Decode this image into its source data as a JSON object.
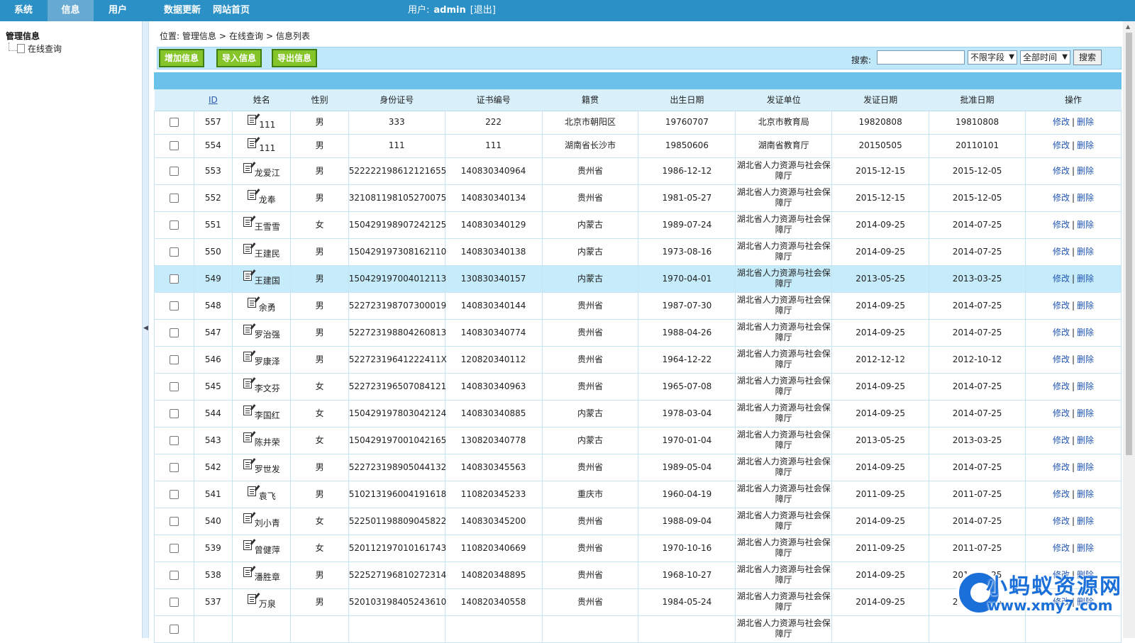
{
  "nav": {
    "items": [
      {
        "label": "系统"
      },
      {
        "label": "信息"
      },
      {
        "label": "用户"
      },
      {
        "label": "数据更新"
      },
      {
        "label": "网站首页"
      }
    ],
    "active_index": 1,
    "user_label": "用户:",
    "username": "admin",
    "logout": "[退出]"
  },
  "sidebar": {
    "root": "管理信息",
    "leaf": "在线查询"
  },
  "breadcrumb": {
    "prefix": "位置:",
    "items": [
      "管理信息",
      "在线查询",
      "信息列表"
    ],
    "sep": ">"
  },
  "toolbar": {
    "add": "增加信息",
    "import": "导入信息",
    "export": "导出信息",
    "search_label": "搜索:",
    "search_value": "",
    "field_select": "不限字段",
    "time_select": "全部时间",
    "search_button": "搜索"
  },
  "table": {
    "headers": [
      "",
      "ID",
      "姓名",
      "性别",
      "身份证号",
      "证书编号",
      "籍贯",
      "出生日期",
      "发证单位",
      "发证日期",
      "批准日期",
      "操作"
    ],
    "edit_label": "修改",
    "delete_label": "删除",
    "op_sep": "|",
    "highlight_id": "549",
    "rows": [
      {
        "id": "557",
        "name": "111",
        "gender": "男",
        "idno": "333",
        "cert": "222",
        "origin": "北京市朝阳区",
        "birth": "19760707",
        "issuer": "北京市教育局",
        "issue_date": "19820808",
        "approve_date": "19810808"
      },
      {
        "id": "554",
        "name": "111",
        "gender": "男",
        "idno": "111",
        "cert": "111",
        "origin": "湖南省长沙市",
        "birth": "19850606",
        "issuer": "湖南省教育厅",
        "issue_date": "20150505",
        "approve_date": "20110101"
      },
      {
        "id": "553",
        "name": "龙爱江",
        "gender": "男",
        "idno": "522222198612121655",
        "cert": "140830340964",
        "origin": "贵州省",
        "birth": "1986-12-12",
        "issuer": "湖北省人力资源与社会保障厅",
        "issue_date": "2015-12-15",
        "approve_date": "2015-12-05"
      },
      {
        "id": "552",
        "name": "龙奉",
        "gender": "男",
        "idno": "321081198105270075",
        "cert": "140830340134",
        "origin": "贵州省",
        "birth": "1981-05-27",
        "issuer": "湖北省人力资源与社会保障厅",
        "issue_date": "2015-12-15",
        "approve_date": "2015-12-05"
      },
      {
        "id": "551",
        "name": "王雪雪",
        "gender": "女",
        "idno": "150429198907242125",
        "cert": "140830340129",
        "origin": "内蒙古",
        "birth": "1989-07-24",
        "issuer": "湖北省人力资源与社会保障厅",
        "issue_date": "2014-09-25",
        "approve_date": "2014-07-25"
      },
      {
        "id": "550",
        "name": "王建民",
        "gender": "男",
        "idno": "150429197308162110",
        "cert": "140830340138",
        "origin": "内蒙古",
        "birth": "1973-08-16",
        "issuer": "湖北省人力资源与社会保障厅",
        "issue_date": "2014-09-25",
        "approve_date": "2014-07-25"
      },
      {
        "id": "549",
        "name": "王建国",
        "gender": "男",
        "idno": "150429197004012113",
        "cert": "130830340157",
        "origin": "内蒙古",
        "birth": "1970-04-01",
        "issuer": "湖北省人力资源与社会保障厅",
        "issue_date": "2013-05-25",
        "approve_date": "2013-03-25"
      },
      {
        "id": "548",
        "name": "余勇",
        "gender": "男",
        "idno": "522723198707300019",
        "cert": "140830340144",
        "origin": "贵州省",
        "birth": "1987-07-30",
        "issuer": "湖北省人力资源与社会保障厅",
        "issue_date": "2014-09-25",
        "approve_date": "2014-07-25"
      },
      {
        "id": "547",
        "name": "罗治强",
        "gender": "男",
        "idno": "522723198804260813",
        "cert": "140830340774",
        "origin": "贵州省",
        "birth": "1988-04-26",
        "issuer": "湖北省人力资源与社会保障厅",
        "issue_date": "2014-09-25",
        "approve_date": "2014-07-25"
      },
      {
        "id": "546",
        "name": "罗康泽",
        "gender": "男",
        "idno": "52272319641222411X",
        "cert": "120820340112",
        "origin": "贵州省",
        "birth": "1964-12-22",
        "issuer": "湖北省人力资源与社会保障厅",
        "issue_date": "2012-12-12",
        "approve_date": "2012-10-12"
      },
      {
        "id": "545",
        "name": "李文芬",
        "gender": "女",
        "idno": "522723196507084121",
        "cert": "140830340963",
        "origin": "贵州省",
        "birth": "1965-07-08",
        "issuer": "湖北省人力资源与社会保障厅",
        "issue_date": "2014-09-25",
        "approve_date": "2014-07-25"
      },
      {
        "id": "544",
        "name": "李国红",
        "gender": "女",
        "idno": "150429197803042124",
        "cert": "140830340885",
        "origin": "内蒙古",
        "birth": "1978-03-04",
        "issuer": "湖北省人力资源与社会保障厅",
        "issue_date": "2014-09-25",
        "approve_date": "2014-07-25"
      },
      {
        "id": "543",
        "name": "陈井荣",
        "gender": "女",
        "idno": "150429197001042165",
        "cert": "130820340778",
        "origin": "内蒙古",
        "birth": "1970-01-04",
        "issuer": "湖北省人力资源与社会保障厅",
        "issue_date": "2013-05-25",
        "approve_date": "2013-03-25"
      },
      {
        "id": "542",
        "name": "罗世发",
        "gender": "男",
        "idno": "522723198905044132",
        "cert": "140830345563",
        "origin": "贵州省",
        "birth": "1989-05-04",
        "issuer": "湖北省人力资源与社会保障厅",
        "issue_date": "2014-09-25",
        "approve_date": "2014-07-25"
      },
      {
        "id": "541",
        "name": "袁飞",
        "gender": "男",
        "idno": "510213196004191618",
        "cert": "110820345233",
        "origin": "重庆市",
        "birth": "1960-04-19",
        "issuer": "湖北省人力资源与社会保障厅",
        "issue_date": "2011-09-25",
        "approve_date": "2011-07-25"
      },
      {
        "id": "540",
        "name": "刘小青",
        "gender": "女",
        "idno": "522501198809045822",
        "cert": "140830345200",
        "origin": "贵州省",
        "birth": "1988-09-04",
        "issuer": "湖北省人力资源与社会保障厅",
        "issue_date": "2014-09-25",
        "approve_date": "2014-07-25"
      },
      {
        "id": "539",
        "name": "曾健萍",
        "gender": "女",
        "idno": "520112197010161743",
        "cert": "110820340669",
        "origin": "贵州省",
        "birth": "1970-10-16",
        "issuer": "湖北省人力资源与社会保障厅",
        "issue_date": "2011-09-25",
        "approve_date": "2011-07-25"
      },
      {
        "id": "538",
        "name": "潘胜章",
        "gender": "男",
        "idno": "522527196810272314",
        "cert": "140820348895",
        "origin": "贵州省",
        "birth": "1968-10-27",
        "issuer": "湖北省人力资源与社会保障厅",
        "issue_date": "2014-09-25",
        "approve_date": "2014-07-25"
      },
      {
        "id": "537",
        "name": "万泉",
        "gender": "男",
        "idno": "520103198405243610",
        "cert": "140820340558",
        "origin": "贵州省",
        "birth": "1984-05-24",
        "issuer": "湖北省人力资源与社会保障厅",
        "issue_date": "2014-09-25",
        "approve_date": "2014-07-25"
      },
      {
        "id": "",
        "name": "",
        "gender": "",
        "idno": "",
        "cert": "",
        "origin": "",
        "birth": "",
        "issuer": "湖北省人力资源与社会保障厅",
        "issue_date": "",
        "approve_date": ""
      }
    ]
  },
  "watermark": {
    "line1": "小蚂蚁资源网",
    "line2": "www.xmy7.com"
  },
  "colors": {
    "nav_bg": "#2a90c6",
    "nav_active": "#66a9d3",
    "toolbar_bg": "#bfe8fb",
    "button_green": "#86c52a",
    "header_bar": "#6cc1ea",
    "row_highlight": "#c6ebfa",
    "link_blue": "#2156b3"
  }
}
